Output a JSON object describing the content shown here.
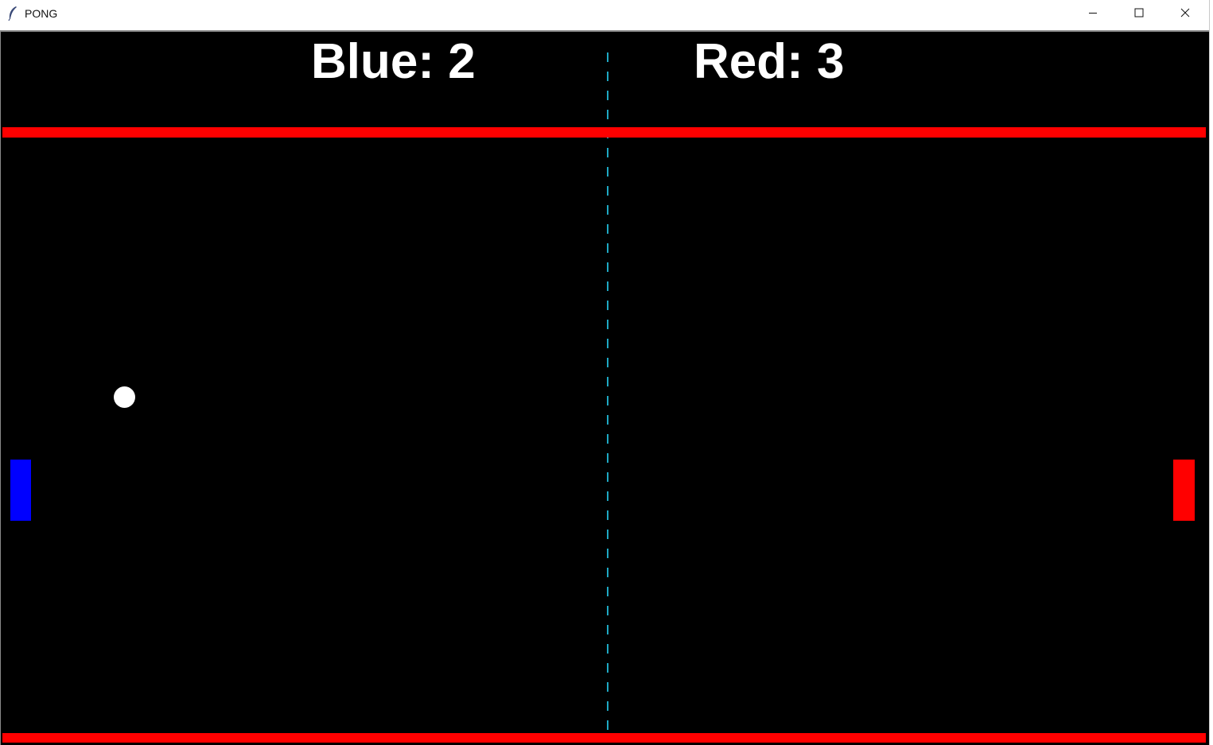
{
  "window": {
    "title": "PONG",
    "icon": "feather-icon",
    "controls": {
      "minimize_icon": "minimize-icon",
      "maximize_icon": "maximize-icon",
      "close_icon": "close-icon"
    }
  },
  "game": {
    "scores": {
      "blue_label": "Blue: 2",
      "red_label": "Red: 3"
    },
    "colors": {
      "background": "#000000",
      "walls": "#ff0000",
      "blue_paddle": "#0000ff",
      "red_paddle": "#ff0000",
      "ball": "#ffffff",
      "center_line": "#1ea8c3",
      "score_text": "#ffffff"
    }
  }
}
